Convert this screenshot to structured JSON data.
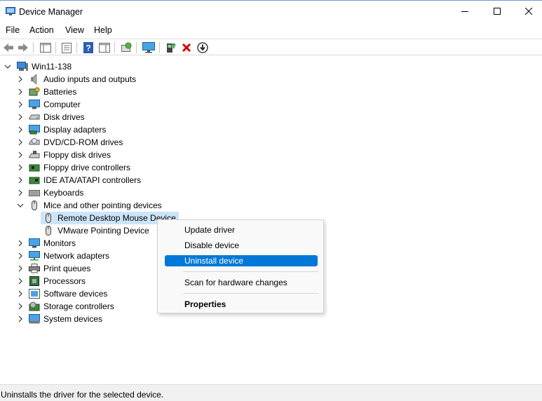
{
  "window": {
    "title": "Device Manager"
  },
  "menu": {
    "items": [
      "File",
      "Action",
      "View",
      "Help"
    ]
  },
  "toolbar": {
    "buttons": [
      "back-icon",
      "forward-icon",
      "show-hide-console-tree-icon",
      "properties-icon",
      "help-icon",
      "action-pane-icon",
      "scan-hardware-icon",
      "monitor-icon",
      "update-driver-icon",
      "uninstall-icon",
      "disable-device-icon"
    ]
  },
  "tree": {
    "root": "Win11-138",
    "categories": [
      "Audio inputs and outputs",
      "Batteries",
      "Computer",
      "Disk drives",
      "Display adapters",
      "DVD/CD-ROM drives",
      "Floppy disk drives",
      "Floppy drive controllers",
      "IDE ATA/ATAPI controllers",
      "Keyboards",
      "Mice and other pointing devices",
      "Monitors",
      "Network adapters",
      "Print queues",
      "Processors",
      "Software devices",
      "Storage controllers",
      "System devices"
    ],
    "mice_children": [
      "Remote Desktop Mouse Device",
      "VMware Pointing Device"
    ]
  },
  "context_menu": {
    "update": "Update driver",
    "disable": "Disable device",
    "uninstall": "Uninstall device",
    "scan": "Scan for hardware changes",
    "properties": "Properties"
  },
  "status": {
    "text": "Uninstalls the driver for the selected device."
  },
  "colors": {
    "highlight": "#0078d7",
    "selection": "#cce4f7",
    "uninstall_red": "#d40000"
  }
}
